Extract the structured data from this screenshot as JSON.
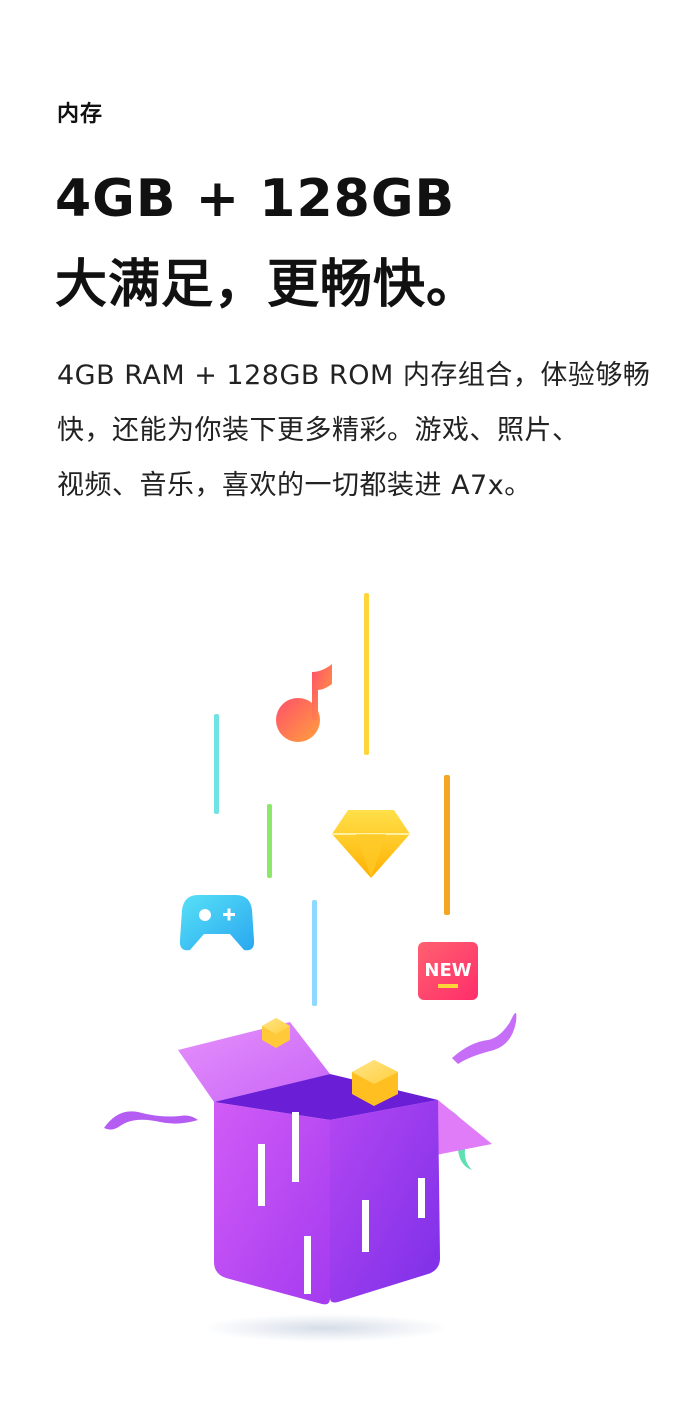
{
  "section": {
    "eyebrow": "内存",
    "headline_lines": [
      "4GB + 128GB",
      "大满足，更畅快。"
    ],
    "description_lines": [
      "4GB RAM + 128GB ROM 内存组合，体验够畅",
      "快，还能为你装下更多精彩。游戏、照片、",
      "视频、音乐，喜欢的一切都装进 A7x。"
    ]
  },
  "illustration": {
    "badge_text": "NEW",
    "icons": [
      "music-note-icon",
      "diamond-icon",
      "gamepad-icon",
      "new-badge-icon",
      "gift-box-icon"
    ],
    "colors": {
      "box_main": "#c44ef0",
      "box_dark": "#6a1fd6",
      "box_light": "#e07cf8",
      "music": "#ff6a3d",
      "diamond": "#ffc300",
      "gamepad": "#38c9f2",
      "badge": "#ff3b63",
      "yellow_line": "#ffd63a",
      "orange_line": "#f5a623",
      "cyan_line": "#6fe3e3",
      "green_line": "#8ce86a",
      "blue_line": "#8fd8ff"
    }
  }
}
